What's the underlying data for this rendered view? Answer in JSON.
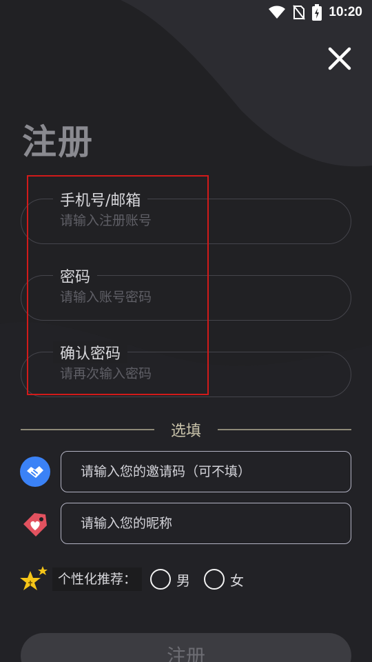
{
  "status_bar": {
    "time": "10:20"
  },
  "page": {
    "title": "注册",
    "close_icon": "close-icon"
  },
  "fields": [
    {
      "label": "手机号/邮箱",
      "placeholder": "请输入注册账号",
      "value": ""
    },
    {
      "label": "密码",
      "placeholder": "请输入账号密码",
      "value": ""
    },
    {
      "label": "确认密码",
      "placeholder": "请再次输入密码",
      "value": ""
    }
  ],
  "optional": {
    "divider_label": "选填",
    "invite": {
      "placeholder": "请输入您的邀请码（可不填）",
      "icon": "handshake-icon"
    },
    "nickname": {
      "placeholder": "请输入您的昵称",
      "icon": "tag-heart-icon"
    }
  },
  "preference": {
    "label": "个性化推荐：",
    "options": [
      "男",
      "女"
    ],
    "icon": "star-icon"
  },
  "submit": {
    "label": "注册"
  },
  "colors": {
    "background": "#212124",
    "wave": "#2c2c31",
    "highlight": "#d21a1a",
    "accent_blue": "#3b82f6",
    "accent_red": "#e2525f",
    "star_yellow": "#f5c518"
  }
}
